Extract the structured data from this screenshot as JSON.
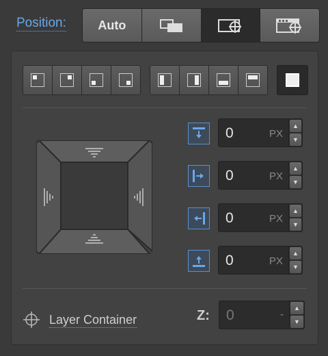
{
  "position_label": "Position:",
  "mode_buttons": [
    {
      "label": "Auto",
      "icon": ""
    },
    {
      "label": "",
      "icon": "overlap-icon"
    },
    {
      "label": "",
      "icon": "layer-target-icon"
    },
    {
      "label": "",
      "icon": "browser-target-icon"
    }
  ],
  "active_mode_index": 2,
  "anchor_groups": {
    "corners": [
      "anchor-top-left-icon",
      "anchor-top-right-icon",
      "anchor-bottom-left-icon",
      "anchor-bottom-right-icon"
    ],
    "edges": [
      "stretch-left-icon",
      "stretch-right-icon",
      "stretch-bottom-icon",
      "stretch-top-icon"
    ],
    "fill": "fill-icon"
  },
  "offsets": [
    {
      "side": "top",
      "value": "0",
      "unit": "PX"
    },
    {
      "side": "left",
      "value": "0",
      "unit": "PX"
    },
    {
      "side": "right",
      "value": "0",
      "unit": "PX"
    },
    {
      "side": "bottom",
      "value": "0",
      "unit": "PX"
    }
  ],
  "layer_container": {
    "label": "Layer Container"
  },
  "z_index": {
    "label": "Z:",
    "value": "0",
    "unit": "-"
  },
  "colors": {
    "accent": "#6aa7ea",
    "panel": "#424242",
    "field": "#2c2c2c"
  }
}
